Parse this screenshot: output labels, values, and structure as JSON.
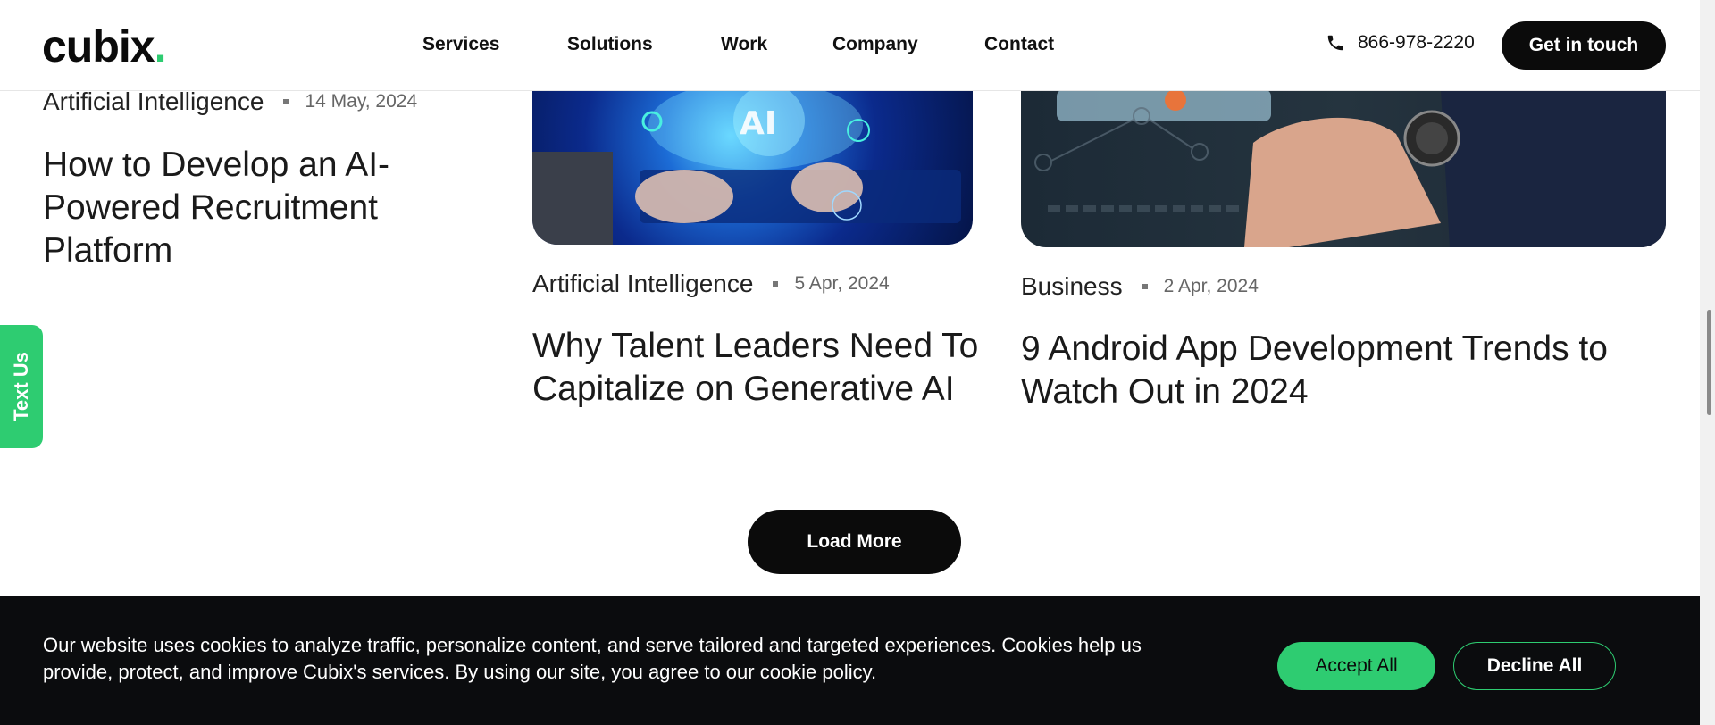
{
  "header": {
    "logo_text": "cubix",
    "logo_dot": ".",
    "nav": [
      {
        "label": "Services"
      },
      {
        "label": "Solutions"
      },
      {
        "label": "Work"
      },
      {
        "label": "Company"
      },
      {
        "label": "Contact"
      }
    ],
    "phone": "866-978-2220",
    "cta_label": "Get in touch"
  },
  "side_tab": {
    "label": "Text Us"
  },
  "posts": [
    {
      "category": "Artificial Intelligence",
      "date": "14 May, 2024",
      "title": "How to Develop an AI-Powered Recruitment Platform"
    },
    {
      "category": "Artificial Intelligence",
      "date": "5 Apr, 2024",
      "title": "Why Talent Leaders Need To Capitalize on Generative AI"
    },
    {
      "category": "Business",
      "date": "2 Apr, 2024",
      "title": "9 Android App Development Trends to Watch Out in 2024"
    }
  ],
  "load_more_label": "Load More",
  "cookie": {
    "text": "Our website uses cookies to analyze traffic, personalize content, and serve tailored and targeted experiences. Cookies help us provide, protect, and improve Cubix's services. By using our site, you agree to our cookie policy.",
    "accept_label": "Accept All",
    "decline_label": "Decline All"
  },
  "colors": {
    "accent": "#2ecc71",
    "dark": "#0b0b0b"
  }
}
